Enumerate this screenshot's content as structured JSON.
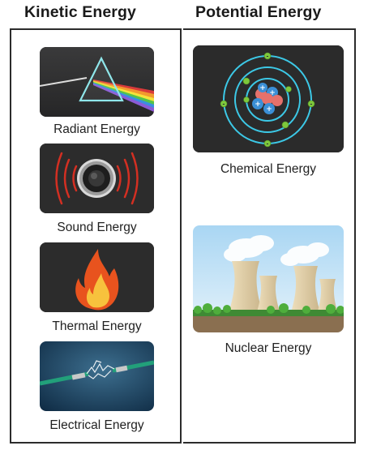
{
  "columns": {
    "kinetic": {
      "heading": "Kinetic Energy",
      "items": [
        {
          "label": "Radiant Energy",
          "icon": "prism-icon"
        },
        {
          "label": "Sound Energy",
          "icon": "speaker-icon"
        },
        {
          "label": "Thermal Energy",
          "icon": "flame-icon"
        },
        {
          "label": "Electrical Energy",
          "icon": "lightning-wire-icon"
        }
      ]
    },
    "potential": {
      "heading": "Potential Energy",
      "items": [
        {
          "label": "Chemical Energy",
          "icon": "atom-icon"
        },
        {
          "label": "Nuclear Energy",
          "icon": "cooling-tower-icon"
        }
      ]
    }
  },
  "colors": {
    "tile_dark": "#2e2e2e",
    "frame": "#2c2c2c",
    "atom_orbit": "#3cc8e6",
    "electron": "#7ec83c",
    "proton": "#e5716b",
    "neutron": "#3b8fd6",
    "flame_outer": "#e8531e",
    "flame_inner": "#f7c23d",
    "sky": "#c8e4f6",
    "grass": "#4a9a3a"
  }
}
